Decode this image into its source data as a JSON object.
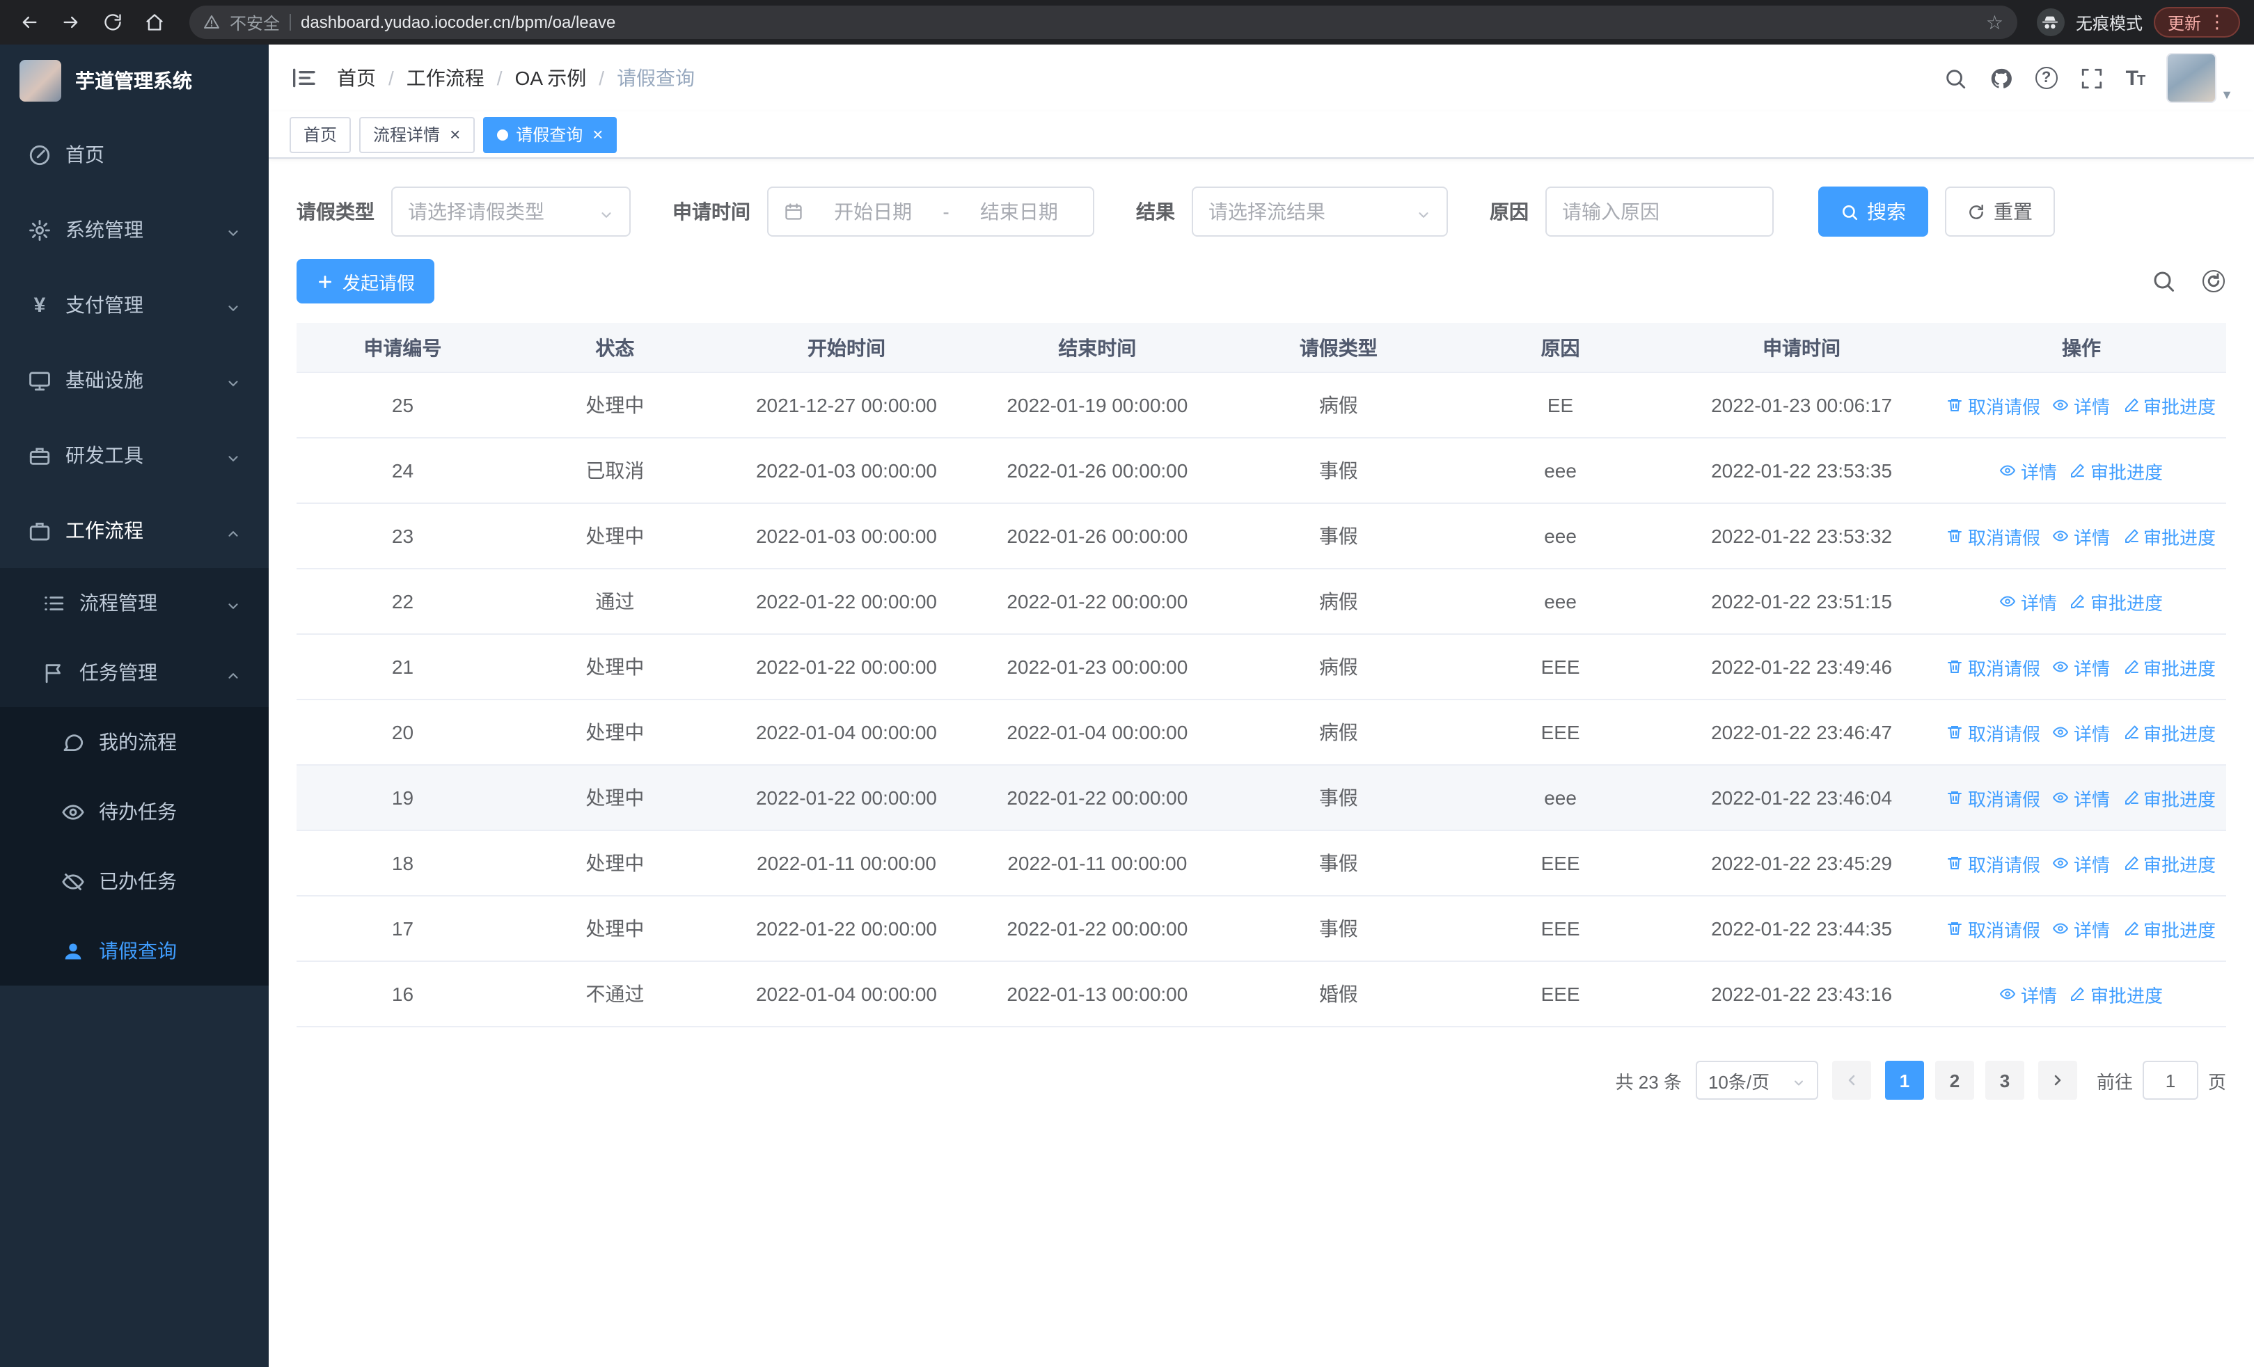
{
  "browser": {
    "security_label": "不安全",
    "url": "dashboard.yudao.iocoder.cn/bpm/oa/leave",
    "incognito_label": "无痕模式",
    "update_label": "更新"
  },
  "sidebar": {
    "logo_title": "芋道管理系统",
    "items": [
      {
        "label": "首页",
        "icon": "dashboard-icon"
      },
      {
        "label": "系统管理",
        "icon": "gear-icon"
      },
      {
        "label": "支付管理",
        "icon": "yen-icon"
      },
      {
        "label": "基础设施",
        "icon": "monitor-icon"
      },
      {
        "label": "研发工具",
        "icon": "toolbox-icon"
      },
      {
        "label": "工作流程",
        "icon": "briefcase-icon"
      }
    ],
    "workflow_children": [
      {
        "label": "流程管理",
        "icon": "list-icon"
      },
      {
        "label": "任务管理",
        "icon": "flag-icon"
      }
    ],
    "task_children": [
      {
        "label": "我的流程",
        "icon": "chat-icon"
      },
      {
        "label": "待办任务",
        "icon": "eye-icon"
      },
      {
        "label": "已办任务",
        "icon": "eye-off-icon"
      },
      {
        "label": "请假查询",
        "icon": "user-icon"
      }
    ]
  },
  "header": {
    "breadcrumb": [
      "首页",
      "工作流程",
      "OA 示例",
      "请假查询"
    ]
  },
  "tags": [
    {
      "label": "首页"
    },
    {
      "label": "流程详情"
    },
    {
      "label": "请假查询"
    }
  ],
  "filters": {
    "leave_type_label": "请假类型",
    "leave_type_placeholder": "请选择请假类型",
    "apply_time_label": "申请时间",
    "start_date_placeholder": "开始日期",
    "range_separator": "-",
    "end_date_placeholder": "结束日期",
    "result_label": "结果",
    "result_placeholder": "请选择流结果",
    "reason_label": "原因",
    "reason_placeholder": "请输入原因",
    "search_label": "搜索",
    "reset_label": "重置"
  },
  "toolbar": {
    "create_label": "发起请假"
  },
  "table": {
    "columns": [
      "申请编号",
      "状态",
      "开始时间",
      "结束时间",
      "请假类型",
      "原因",
      "申请时间",
      "操作"
    ],
    "action_defs": {
      "cancel": {
        "label": "取消请假",
        "icon": "delete-icon"
      },
      "detail": {
        "label": "详情",
        "icon": "view-icon"
      },
      "progress": {
        "label": "审批进度",
        "icon": "edit-icon"
      }
    },
    "rows": [
      {
        "id": "25",
        "status": "处理中",
        "start": "2021-12-27 00:00:00",
        "end": "2022-01-19 00:00:00",
        "type": "病假",
        "reason": "EE",
        "applied": "2022-01-23 00:06:17",
        "actions": [
          "cancel",
          "detail",
          "progress"
        ]
      },
      {
        "id": "24",
        "status": "已取消",
        "start": "2022-01-03 00:00:00",
        "end": "2022-01-26 00:00:00",
        "type": "事假",
        "reason": "eee",
        "applied": "2022-01-22 23:53:35",
        "actions": [
          "detail",
          "progress"
        ]
      },
      {
        "id": "23",
        "status": "处理中",
        "start": "2022-01-03 00:00:00",
        "end": "2022-01-26 00:00:00",
        "type": "事假",
        "reason": "eee",
        "applied": "2022-01-22 23:53:32",
        "actions": [
          "cancel",
          "detail",
          "progress"
        ]
      },
      {
        "id": "22",
        "status": "通过",
        "start": "2022-01-22 00:00:00",
        "end": "2022-01-22 00:00:00",
        "type": "病假",
        "reason": "eee",
        "applied": "2022-01-22 23:51:15",
        "actions": [
          "detail",
          "progress"
        ]
      },
      {
        "id": "21",
        "status": "处理中",
        "start": "2022-01-22 00:00:00",
        "end": "2022-01-23 00:00:00",
        "type": "病假",
        "reason": "EEE",
        "applied": "2022-01-22 23:49:46",
        "actions": [
          "cancel",
          "detail",
          "progress"
        ]
      },
      {
        "id": "20",
        "status": "处理中",
        "start": "2022-01-04 00:00:00",
        "end": "2022-01-04 00:00:00",
        "type": "病假",
        "reason": "EEE",
        "applied": "2022-01-22 23:46:47",
        "actions": [
          "cancel",
          "detail",
          "progress"
        ]
      },
      {
        "id": "19",
        "status": "处理中",
        "start": "2022-01-22 00:00:00",
        "end": "2022-01-22 00:00:00",
        "type": "事假",
        "reason": "eee",
        "applied": "2022-01-22 23:46:04",
        "actions": [
          "cancel",
          "detail",
          "progress"
        ],
        "highlighted": true
      },
      {
        "id": "18",
        "status": "处理中",
        "start": "2022-01-11 00:00:00",
        "end": "2022-01-11 00:00:00",
        "type": "事假",
        "reason": "EEE",
        "applied": "2022-01-22 23:45:29",
        "actions": [
          "cancel",
          "detail",
          "progress"
        ]
      },
      {
        "id": "17",
        "status": "处理中",
        "start": "2022-01-22 00:00:00",
        "end": "2022-01-22 00:00:00",
        "type": "事假",
        "reason": "EEE",
        "applied": "2022-01-22 23:44:35",
        "actions": [
          "cancel",
          "detail",
          "progress"
        ]
      },
      {
        "id": "16",
        "status": "不通过",
        "start": "2022-01-04 00:00:00",
        "end": "2022-01-13 00:00:00",
        "type": "婚假",
        "reason": "EEE",
        "applied": "2022-01-22 23:43:16",
        "actions": [
          "detail",
          "progress"
        ]
      }
    ]
  },
  "pagination": {
    "total_text": "共 23 条",
    "page_size": "10条/页",
    "pages": [
      "1",
      "2",
      "3"
    ],
    "active_page": "1",
    "goto_label": "前往",
    "goto_value": "1",
    "goto_suffix": "页"
  },
  "colors": {
    "primary": "#409eff",
    "sidebar_bg": "#1d2b3a",
    "chrome_bg": "#202124",
    "update_pill": "#f6aea9"
  }
}
